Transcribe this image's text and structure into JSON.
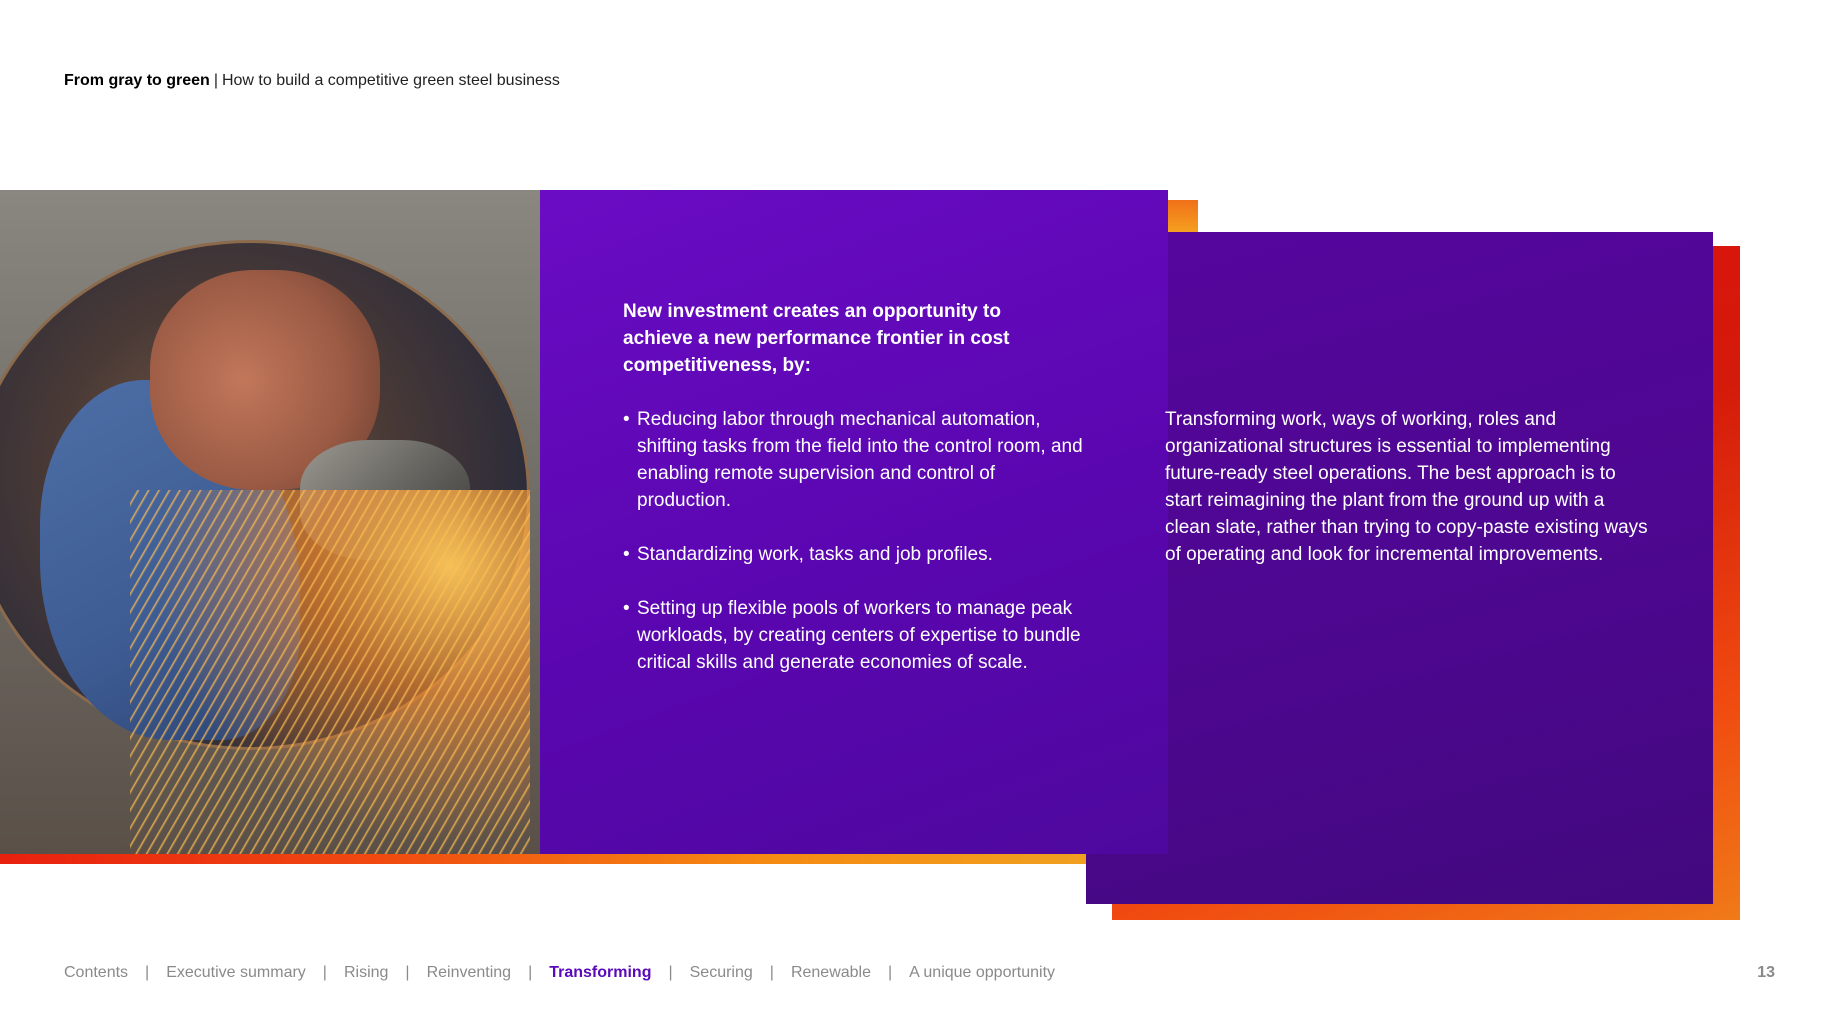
{
  "header": {
    "title": "From gray to green",
    "separator": "|",
    "subtitle": "How to build a competitive green steel business"
  },
  "main": {
    "lead": "New investment creates an opportunity to achieve a new performance frontier in cost competitiveness, by:",
    "bullets": [
      "Reducing labor through mechanical automation, shifting tasks from the field into the control room, and enabling remote supervision and control of production.",
      "Standardizing work, tasks and job profiles.",
      "Setting up flexible pools of workers to manage peak workloads, by creating centers of expertise to bundle critical skills and generate economies of scale."
    ],
    "right_paragraph": "Transforming work, ways of working, roles and organizational structures is essential to implementing future-ready steel operations. The best approach is to start reimagining the plant from the ground up with a clean slate, rather than trying to copy-paste existing ways of operating and look for incremental improvements."
  },
  "footer": {
    "nav": [
      {
        "label": "Contents",
        "active": false
      },
      {
        "label": "Executive summary",
        "active": false
      },
      {
        "label": "Rising",
        "active": false
      },
      {
        "label": "Reinventing",
        "active": false
      },
      {
        "label": "Transforming",
        "active": true
      },
      {
        "label": "Securing",
        "active": false
      },
      {
        "label": "Renewable",
        "active": false
      },
      {
        "label": "A unique opportunity",
        "active": false
      }
    ],
    "divider": "|",
    "page_number": "13"
  },
  "colors": {
    "accent_purple": "#5a0ab8",
    "panel_purple": "#5a06b0",
    "band_orange": "#f04a10",
    "band_red": "#e01010"
  },
  "icons": {
    "photo": "welder-with-grinder-photo"
  }
}
